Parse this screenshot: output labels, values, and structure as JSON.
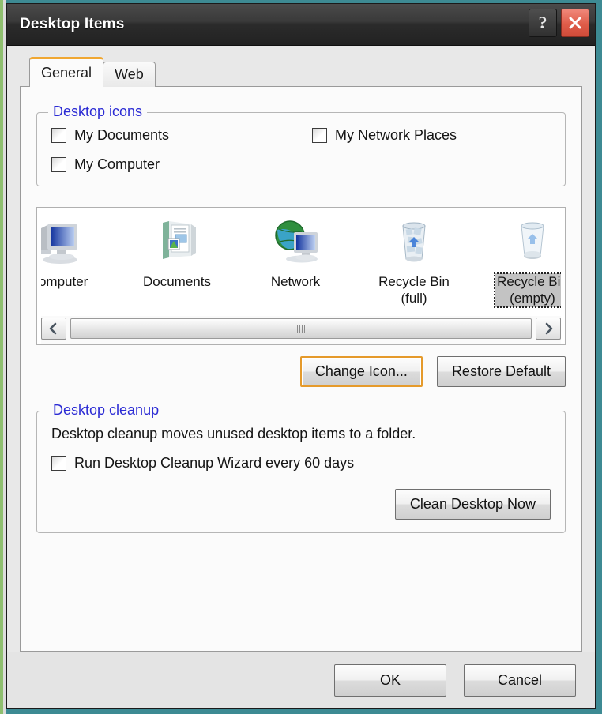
{
  "window": {
    "title": "Desktop Items",
    "help_button": "?",
    "close_button": "close-icon"
  },
  "tabs": [
    {
      "label": "General",
      "active": true
    },
    {
      "label": "Web",
      "active": false
    }
  ],
  "desktop_icons_group": {
    "legend": "Desktop icons",
    "checkboxes": [
      {
        "label": "My Documents",
        "checked": false
      },
      {
        "label": "My Network Places",
        "checked": false
      },
      {
        "label": "My Computer",
        "checked": false
      }
    ]
  },
  "icon_preview": {
    "items": [
      {
        "caption": "Computer",
        "icon": "my-computer-icon",
        "selected": false
      },
      {
        "caption": "Documents",
        "icon": "my-documents-icon",
        "selected": false
      },
      {
        "caption": "Network",
        "icon": "my-network-places-icon",
        "selected": false
      },
      {
        "caption": "Recycle Bin\n(full)",
        "icon": "recycle-bin-full-icon",
        "selected": false
      },
      {
        "caption": "Recycle Bin\n(empty)",
        "icon": "recycle-bin-empty-icon",
        "selected": true
      }
    ],
    "scrollbar": {
      "left_arrow": "‹",
      "right_arrow": "›"
    }
  },
  "icon_buttons": {
    "change_icon": "Change Icon...",
    "restore_default": "Restore Default"
  },
  "desktop_cleanup_group": {
    "legend": "Desktop cleanup",
    "description": "Desktop cleanup moves unused desktop items to a folder.",
    "checkbox": {
      "label": "Run Desktop Cleanup Wizard every 60 days",
      "checked": false
    },
    "clean_now_button": "Clean Desktop Now"
  },
  "footer": {
    "ok": "OK",
    "cancel": "Cancel"
  },
  "colors": {
    "accent_focus": "#e59a2b",
    "legend_blue": "#2b2bd4",
    "close_red": "#df5c49",
    "titlebar_dark": "#2b2b2b",
    "desktop_teal": "#3d8a93"
  }
}
